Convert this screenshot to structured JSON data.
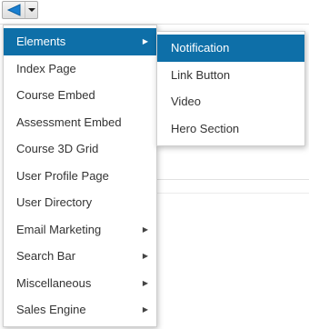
{
  "colors": {
    "active_bg": "#0e6fa8",
    "active_text": "#ffffff",
    "text": "#333333"
  },
  "toolbar": {
    "main_icon": "triangle-left-icon",
    "dropdown_icon": "triangle-down-icon"
  },
  "menu": {
    "items": [
      {
        "label": "Elements",
        "has_submenu": true,
        "active": true
      },
      {
        "label": "Index Page",
        "has_submenu": false
      },
      {
        "label": "Course Embed",
        "has_submenu": false
      },
      {
        "label": "Assessment Embed",
        "has_submenu": false
      },
      {
        "label": "Course 3D Grid",
        "has_submenu": false
      },
      {
        "label": "User Profile Page",
        "has_submenu": false
      },
      {
        "label": "User Directory",
        "has_submenu": false
      },
      {
        "label": "Email Marketing",
        "has_submenu": true
      },
      {
        "label": "Search Bar",
        "has_submenu": true
      },
      {
        "label": "Miscellaneous",
        "has_submenu": true
      },
      {
        "label": "Sales Engine",
        "has_submenu": true
      }
    ]
  },
  "submenu": {
    "items": [
      {
        "label": "Notification",
        "active": true
      },
      {
        "label": "Link Button"
      },
      {
        "label": "Video"
      },
      {
        "label": "Hero Section"
      }
    ]
  }
}
